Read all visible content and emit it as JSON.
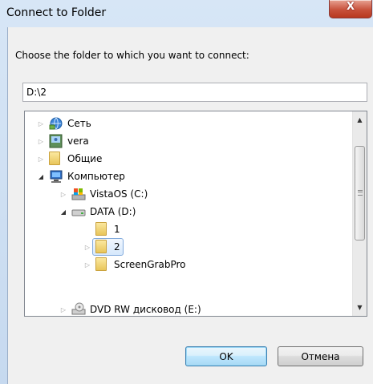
{
  "window": {
    "title": "Connect to Folder",
    "close_glyph": "X"
  },
  "prompt": "Choose the folder to which you want to connect:",
  "path_input": {
    "value": "D:\\2"
  },
  "tree": {
    "items": [
      {
        "label": "Сеть",
        "icon": "network-icon",
        "depth": 0,
        "state": "collapsed",
        "selected": false
      },
      {
        "label": "vera",
        "icon": "computer-user-icon",
        "depth": 0,
        "state": "collapsed",
        "selected": false
      },
      {
        "label": "Общие",
        "icon": "folder-icon",
        "depth": 0,
        "state": "collapsed",
        "selected": false
      },
      {
        "label": "Компьютер",
        "icon": "computer-icon",
        "depth": 0,
        "state": "expanded",
        "selected": false
      },
      {
        "label": "VistaOS (C:)",
        "icon": "system-drive-icon",
        "depth": 1,
        "state": "collapsed",
        "selected": false
      },
      {
        "label": "DATA (D:)",
        "icon": "drive-icon",
        "depth": 1,
        "state": "expanded",
        "selected": false
      },
      {
        "label": "1",
        "icon": "folder-icon",
        "depth": 2,
        "state": "none",
        "selected": false
      },
      {
        "label": "2",
        "icon": "folder-icon",
        "depth": 2,
        "state": "collapsed",
        "selected": true
      },
      {
        "label": "ScreenGrabPro",
        "icon": "folder-icon",
        "depth": 2,
        "state": "collapsed",
        "selected": false
      },
      {
        "label": "DVD RW дисковод (E:)",
        "icon": "dvd-drive-icon",
        "depth": 1,
        "state": "collapsed",
        "selected": false
      }
    ]
  },
  "buttons": {
    "ok": "OK",
    "cancel": "Отмена"
  },
  "colors": {
    "selection_border": "#84acdd",
    "close_button": "#c8523c",
    "default_button_border": "#3c7fb1"
  }
}
